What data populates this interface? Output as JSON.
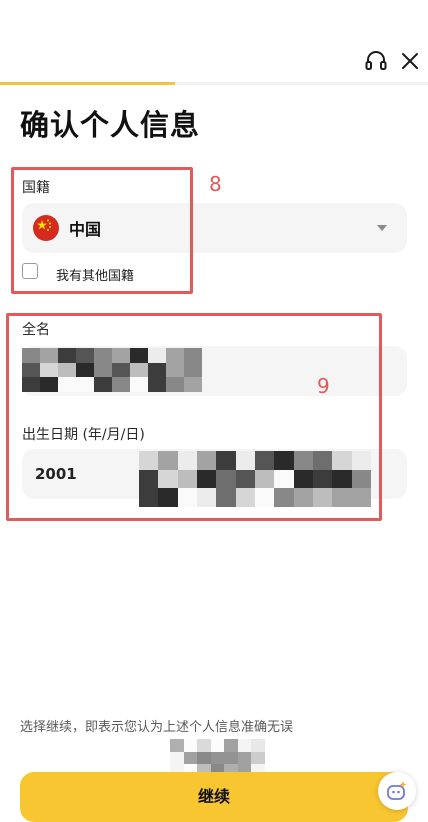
{
  "header": {
    "support_icon": "headset-icon",
    "close_icon": "close-icon",
    "progress_fraction": 0.41
  },
  "title": "确认个人信息",
  "nationality": {
    "label": "国籍",
    "flag_icon": "china-flag-icon",
    "country": "中国",
    "other_nationality_label": "我有其他国籍",
    "other_nationality_checked": false
  },
  "full_name": {
    "label": "全名"
  },
  "birth_date": {
    "label": "出生日期 (年/月/日)",
    "year": "2001"
  },
  "annotations": {
    "box_8": "8",
    "box_9": "9"
  },
  "footer": {
    "disclaimer": "选择继续，即表示您认为上述个人信息准确无误",
    "continue_label": "继续",
    "assistant_icon": "sparkle-assistant-icon"
  },
  "colors": {
    "accent": "#f8c630",
    "annotation": "#e35a5a",
    "field_bg": "#f5f5f5"
  }
}
